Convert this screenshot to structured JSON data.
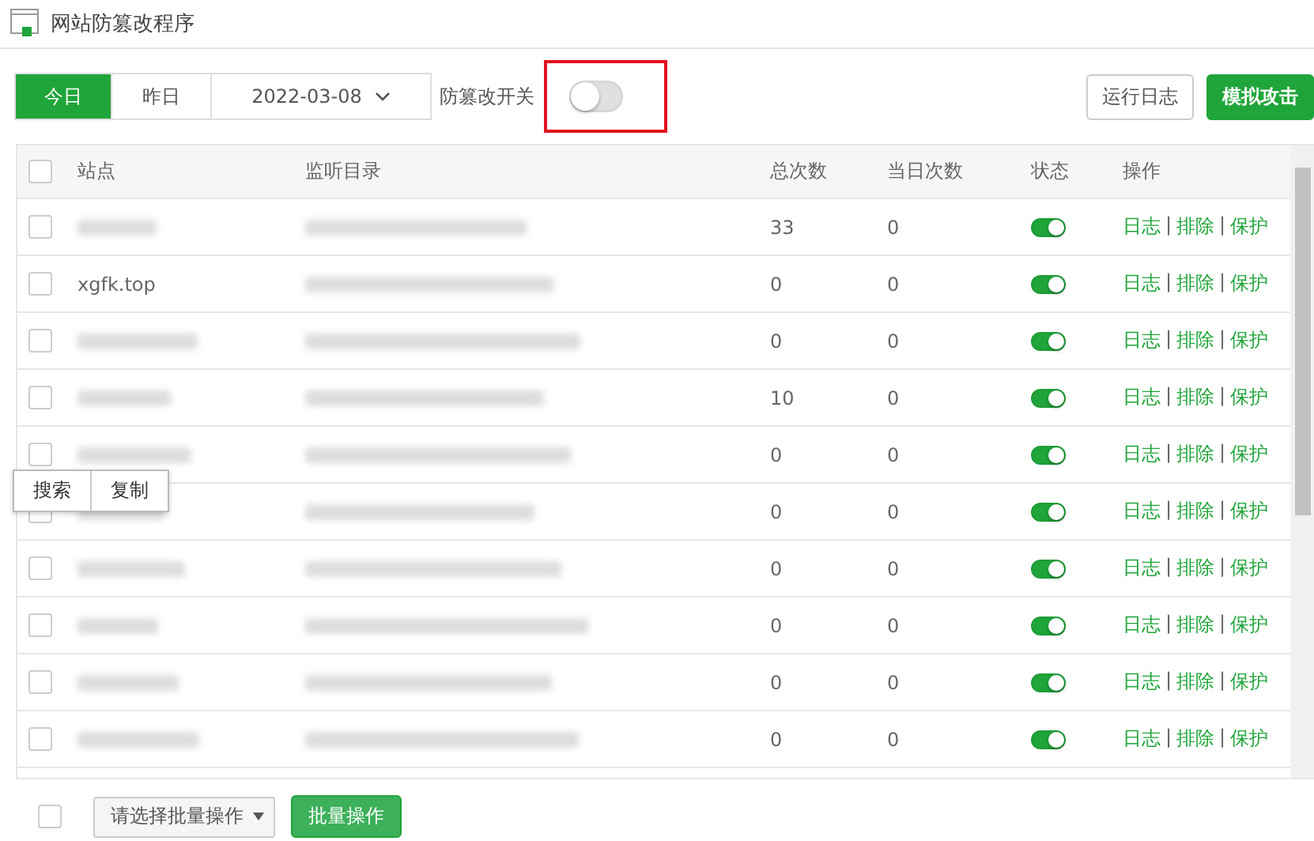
{
  "window": {
    "title": "网站防篡改程序"
  },
  "toolbar": {
    "day_tabs": [
      {
        "label": "今日",
        "selected": true
      },
      {
        "label": "昨日",
        "selected": false
      }
    ],
    "date": "2022-03-08",
    "switch_label": "防篡改开关",
    "switch_on": false,
    "switch_highlighted": true,
    "buttons": [
      {
        "label": "运行日志",
        "kind": "plain"
      },
      {
        "label": "模拟攻击",
        "kind": "primary"
      }
    ]
  },
  "table": {
    "all_checked": false,
    "columns": [
      "站点",
      "监听目录",
      "总次数",
      "当日次数",
      "状态",
      "操作"
    ],
    "rows": [
      {
        "checked": false,
        "site_blurred": true,
        "directory_blurred": true,
        "total": "33",
        "today": "0",
        "on": true,
        "actions": [
          "日志",
          "|",
          "排除",
          "|",
          "保护"
        ]
      },
      {
        "checked": false,
        "site": "xgfk.top",
        "site_blurred": false,
        "directory_blurred": true,
        "total": "0",
        "today": "0",
        "on": true,
        "actions": [
          "日志",
          "|",
          "排除",
          "|",
          "保护"
        ]
      },
      {
        "checked": false,
        "site_blurred": true,
        "directory_blurred": true,
        "total": "0",
        "today": "0",
        "on": true,
        "actions": [
          "日志",
          "|",
          "排除",
          "|",
          "保护"
        ]
      },
      {
        "checked": false,
        "site_blurred": true,
        "directory_blurred": true,
        "total": "10",
        "today": "0",
        "on": true,
        "actions": [
          "日志",
          "|",
          "排除",
          "|",
          "保护"
        ]
      },
      {
        "checked": false,
        "site_blurred": true,
        "directory_blurred": true,
        "total": "0",
        "today": "0",
        "on": true,
        "actions": [
          "日志",
          "|",
          "排除",
          "|",
          "保护"
        ]
      },
      {
        "checked": false,
        "site_blurred": true,
        "directory_blurred": true,
        "total": "0",
        "today": "0",
        "on": true,
        "actions": [
          "日志",
          "|",
          "排除",
          "|",
          "保护"
        ]
      },
      {
        "checked": false,
        "site_blurred": true,
        "directory_blurred": true,
        "total": "0",
        "today": "0",
        "on": true,
        "actions": [
          "日志",
          "|",
          "排除",
          "|",
          "保护"
        ]
      },
      {
        "checked": false,
        "site_blurred": true,
        "directory_blurred": true,
        "total": "0",
        "today": "0",
        "on": true,
        "actions": [
          "日志",
          "|",
          "排除",
          "|",
          "保护"
        ]
      },
      {
        "checked": false,
        "site_blurred": true,
        "directory_blurred": true,
        "total": "0",
        "today": "0",
        "on": true,
        "actions": [
          "日志",
          "|",
          "排除",
          "|",
          "保护"
        ]
      },
      {
        "checked": false,
        "site_blurred": true,
        "directory_blurred": true,
        "total": "0",
        "today": "0",
        "on": true,
        "actions": [
          "日志",
          "|",
          "排除",
          "|",
          "保护"
        ]
      }
    ]
  },
  "context_menu": {
    "items": [
      "搜索",
      "复制"
    ]
  },
  "footer": {
    "all_checked": false,
    "select_placeholder": "请选择批量操作",
    "button": "批量操作"
  }
}
